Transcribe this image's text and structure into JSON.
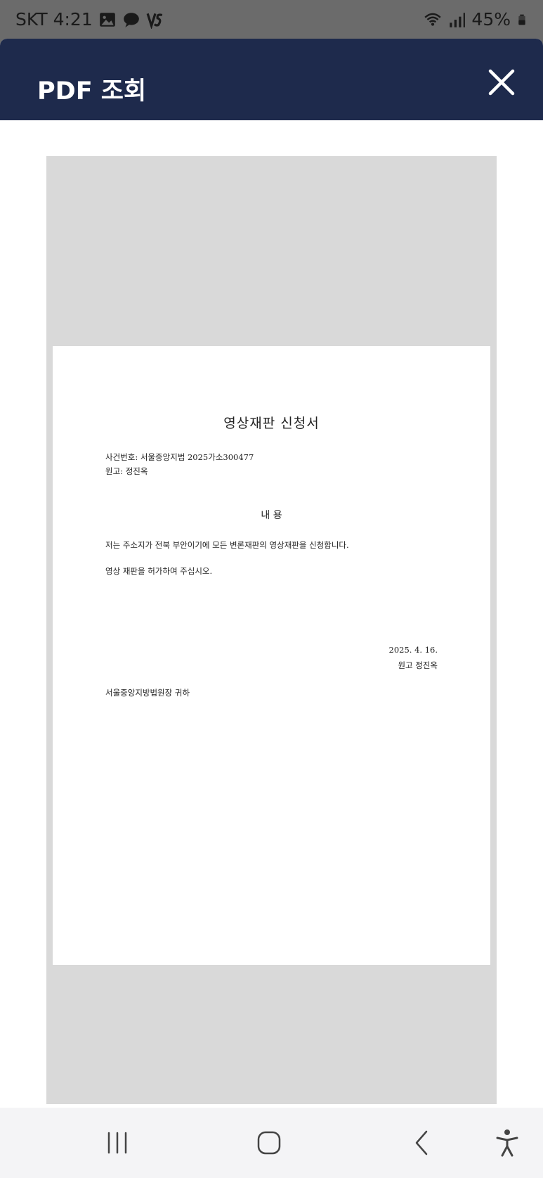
{
  "status_bar": {
    "carrier": "SKT",
    "time": "4:21",
    "battery": "45%",
    "icons": [
      "image-icon",
      "chat-icon",
      "vs-icon",
      "wifi-icon",
      "signal-icon",
      "battery-icon"
    ]
  },
  "header": {
    "title": "PDF 조회",
    "background": "#1e2a4c",
    "close_icon": "close-icon"
  },
  "document": {
    "title": "영상재판 신청서",
    "case_number": "사건번호: 서울중앙지법 2025가소300477",
    "plaintiff": "원고: 정진옥",
    "section_heading": "내 용",
    "body_line_1": "저는 주소지가 전북 부안이기에 모든 변론재판의 영상재판을 신청합니다.",
    "body_line_2": "영상 재판을 허가하여 주십시오.",
    "date": "2025.  4.  16.",
    "signature": "원고 정진옥",
    "addressee": "서울중앙지방법원장 귀하"
  },
  "nav_bar": {
    "icons": [
      "recent-apps-icon",
      "home-icon",
      "back-icon",
      "accessibility-icon"
    ]
  }
}
